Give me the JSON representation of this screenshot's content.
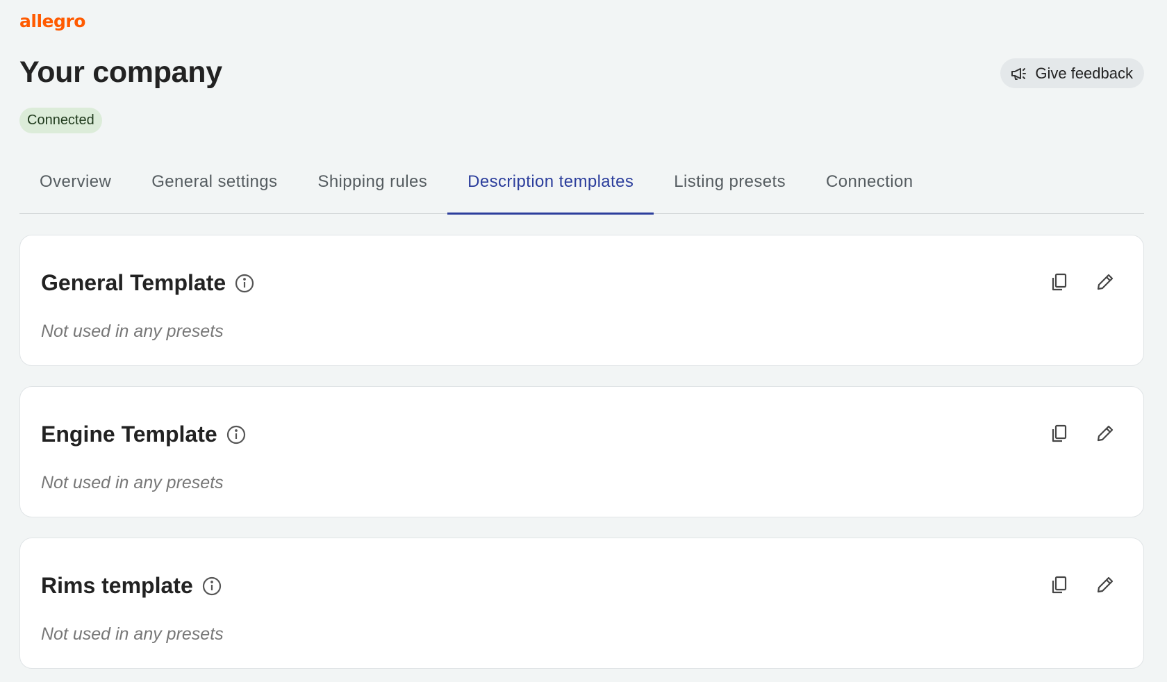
{
  "brand": {
    "logo_text": "allegro",
    "color": "#ff5a00"
  },
  "header": {
    "title": "Your company",
    "status": "Connected",
    "feedback_label": "Give feedback",
    "feedback_icon": "megaphone-icon"
  },
  "tabs": [
    {
      "label": "Overview",
      "active": false
    },
    {
      "label": "General settings",
      "active": false
    },
    {
      "label": "Shipping rules",
      "active": false
    },
    {
      "label": "Description templates",
      "active": true
    },
    {
      "label": "Listing presets",
      "active": false
    },
    {
      "label": "Connection",
      "active": false
    }
  ],
  "templates": [
    {
      "name": "General Template",
      "usage": "Not used in any presets"
    },
    {
      "name": "Engine Template",
      "usage": "Not used in any presets"
    },
    {
      "name": "Rims template",
      "usage": "Not used in any presets"
    }
  ],
  "colors": {
    "accent": "#2c3e9c",
    "status_bg": "#dcecd9",
    "background": "#f2f5f5"
  }
}
